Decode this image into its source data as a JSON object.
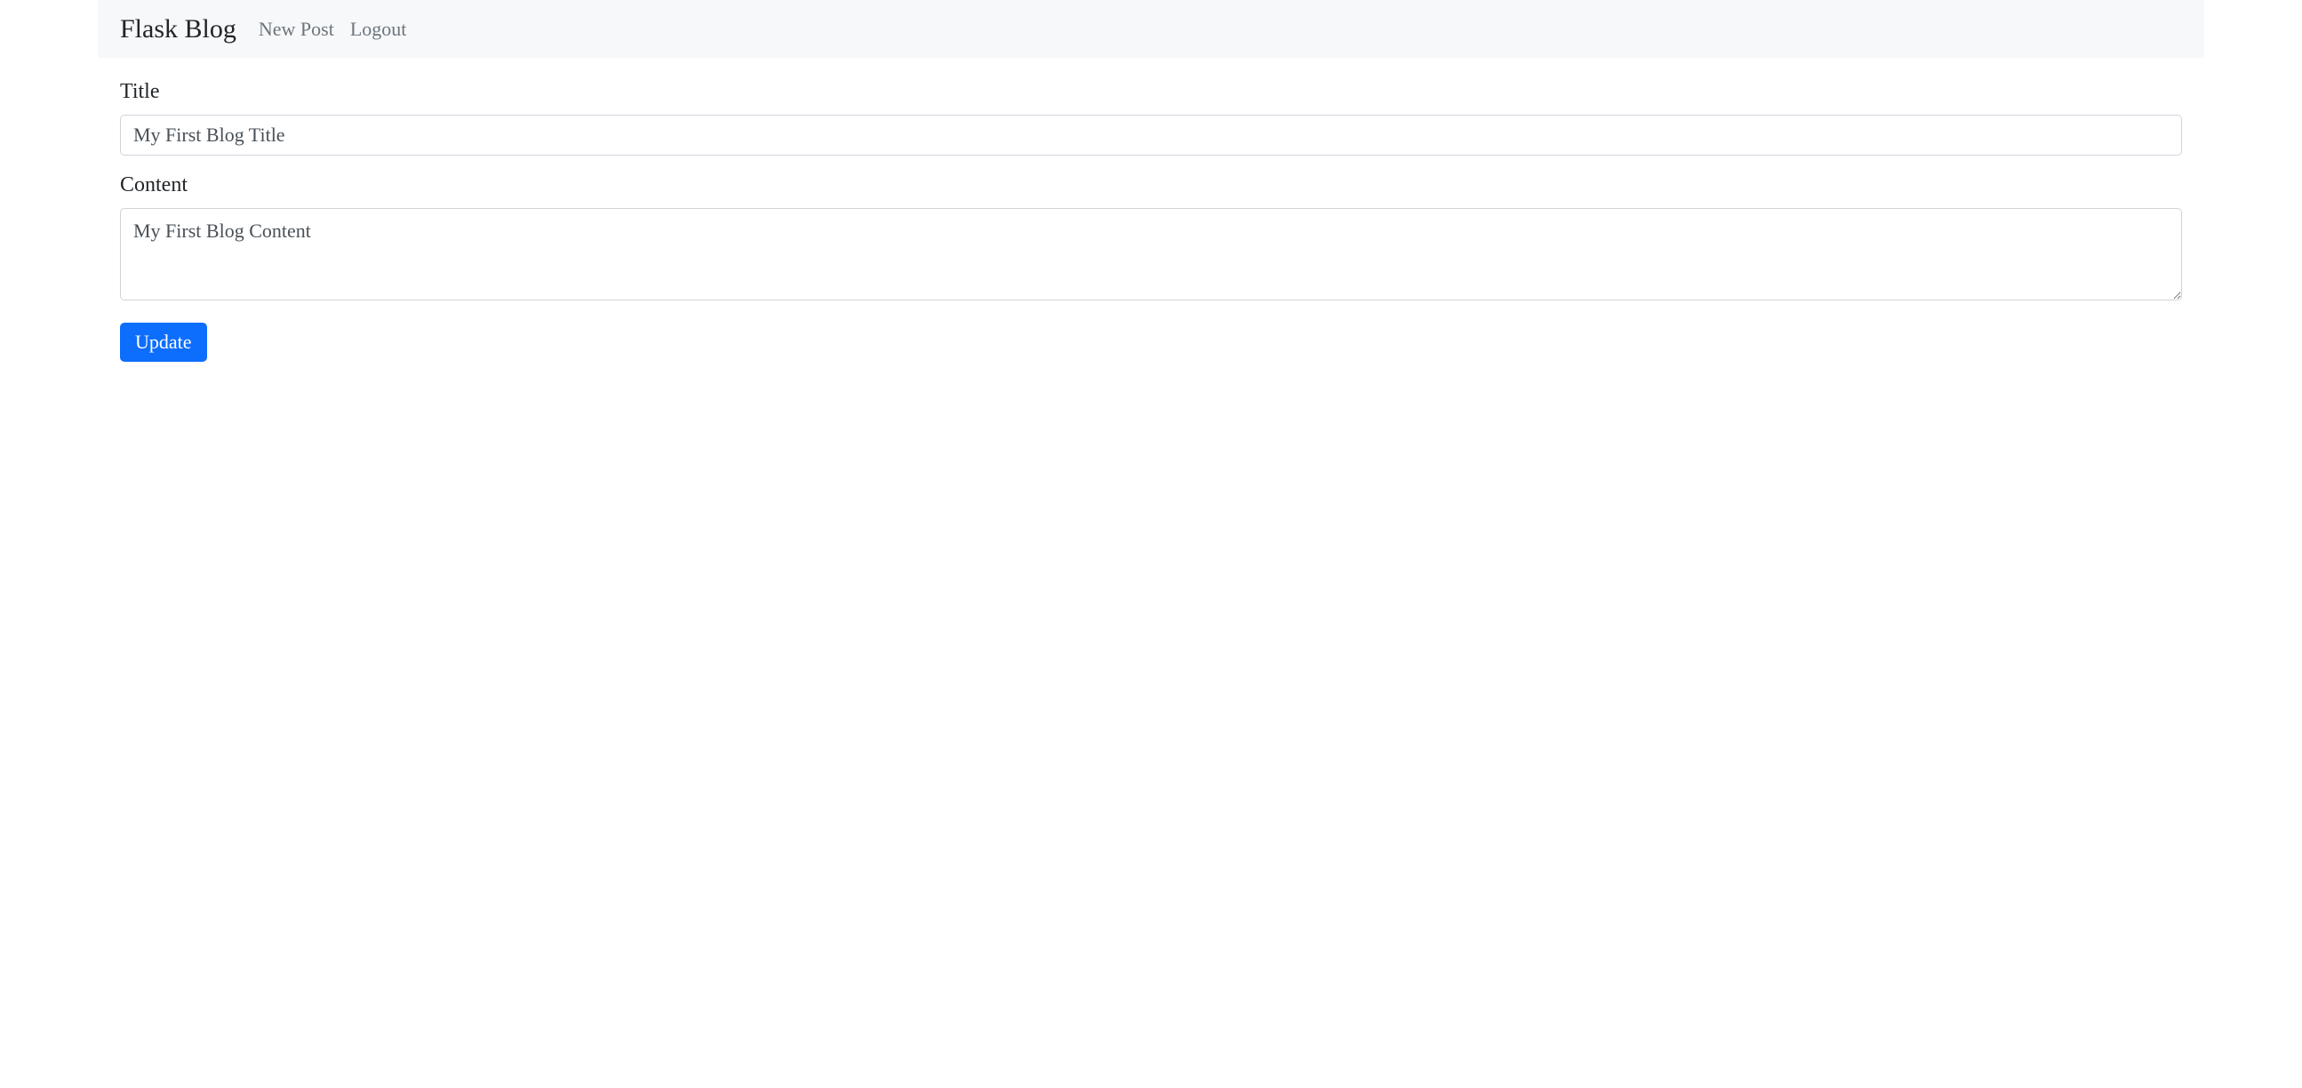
{
  "navbar": {
    "brand": "Flask Blog",
    "links": {
      "new_post": "New Post",
      "logout": "Logout"
    }
  },
  "form": {
    "title_label": "Title",
    "title_value": "My First Blog Title",
    "content_label": "Content",
    "content_value": "My First Blog Content",
    "submit_label": "Update"
  }
}
